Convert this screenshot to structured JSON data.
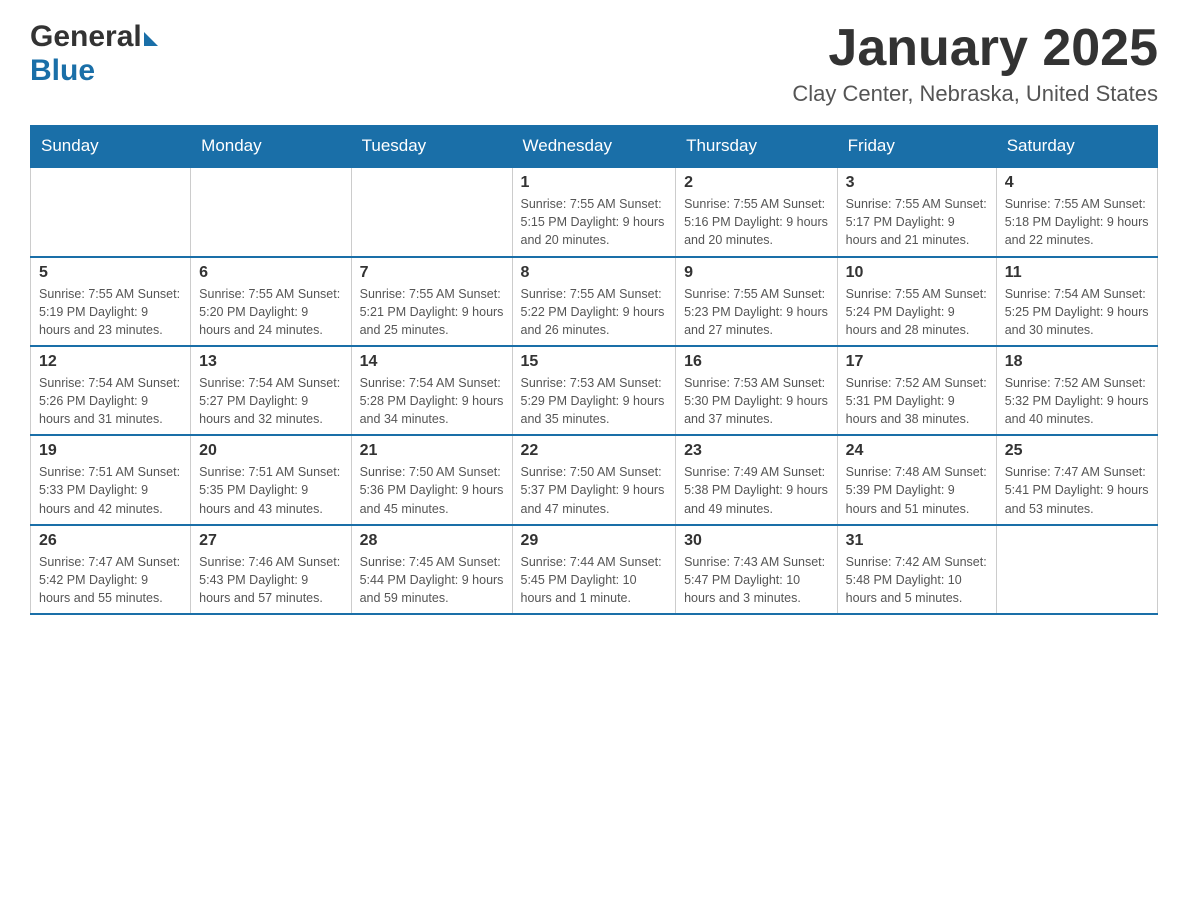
{
  "header": {
    "title": "January 2025",
    "location": "Clay Center, Nebraska, United States",
    "logo_general": "General",
    "logo_blue": "Blue"
  },
  "weekdays": [
    "Sunday",
    "Monday",
    "Tuesday",
    "Wednesday",
    "Thursday",
    "Friday",
    "Saturday"
  ],
  "weeks": [
    [
      {
        "day": "",
        "info": ""
      },
      {
        "day": "",
        "info": ""
      },
      {
        "day": "",
        "info": ""
      },
      {
        "day": "1",
        "info": "Sunrise: 7:55 AM\nSunset: 5:15 PM\nDaylight: 9 hours\nand 20 minutes."
      },
      {
        "day": "2",
        "info": "Sunrise: 7:55 AM\nSunset: 5:16 PM\nDaylight: 9 hours\nand 20 minutes."
      },
      {
        "day": "3",
        "info": "Sunrise: 7:55 AM\nSunset: 5:17 PM\nDaylight: 9 hours\nand 21 minutes."
      },
      {
        "day": "4",
        "info": "Sunrise: 7:55 AM\nSunset: 5:18 PM\nDaylight: 9 hours\nand 22 minutes."
      }
    ],
    [
      {
        "day": "5",
        "info": "Sunrise: 7:55 AM\nSunset: 5:19 PM\nDaylight: 9 hours\nand 23 minutes."
      },
      {
        "day": "6",
        "info": "Sunrise: 7:55 AM\nSunset: 5:20 PM\nDaylight: 9 hours\nand 24 minutes."
      },
      {
        "day": "7",
        "info": "Sunrise: 7:55 AM\nSunset: 5:21 PM\nDaylight: 9 hours\nand 25 minutes."
      },
      {
        "day": "8",
        "info": "Sunrise: 7:55 AM\nSunset: 5:22 PM\nDaylight: 9 hours\nand 26 minutes."
      },
      {
        "day": "9",
        "info": "Sunrise: 7:55 AM\nSunset: 5:23 PM\nDaylight: 9 hours\nand 27 minutes."
      },
      {
        "day": "10",
        "info": "Sunrise: 7:55 AM\nSunset: 5:24 PM\nDaylight: 9 hours\nand 28 minutes."
      },
      {
        "day": "11",
        "info": "Sunrise: 7:54 AM\nSunset: 5:25 PM\nDaylight: 9 hours\nand 30 minutes."
      }
    ],
    [
      {
        "day": "12",
        "info": "Sunrise: 7:54 AM\nSunset: 5:26 PM\nDaylight: 9 hours\nand 31 minutes."
      },
      {
        "day": "13",
        "info": "Sunrise: 7:54 AM\nSunset: 5:27 PM\nDaylight: 9 hours\nand 32 minutes."
      },
      {
        "day": "14",
        "info": "Sunrise: 7:54 AM\nSunset: 5:28 PM\nDaylight: 9 hours\nand 34 minutes."
      },
      {
        "day": "15",
        "info": "Sunrise: 7:53 AM\nSunset: 5:29 PM\nDaylight: 9 hours\nand 35 minutes."
      },
      {
        "day": "16",
        "info": "Sunrise: 7:53 AM\nSunset: 5:30 PM\nDaylight: 9 hours\nand 37 minutes."
      },
      {
        "day": "17",
        "info": "Sunrise: 7:52 AM\nSunset: 5:31 PM\nDaylight: 9 hours\nand 38 minutes."
      },
      {
        "day": "18",
        "info": "Sunrise: 7:52 AM\nSunset: 5:32 PM\nDaylight: 9 hours\nand 40 minutes."
      }
    ],
    [
      {
        "day": "19",
        "info": "Sunrise: 7:51 AM\nSunset: 5:33 PM\nDaylight: 9 hours\nand 42 minutes."
      },
      {
        "day": "20",
        "info": "Sunrise: 7:51 AM\nSunset: 5:35 PM\nDaylight: 9 hours\nand 43 minutes."
      },
      {
        "day": "21",
        "info": "Sunrise: 7:50 AM\nSunset: 5:36 PM\nDaylight: 9 hours\nand 45 minutes."
      },
      {
        "day": "22",
        "info": "Sunrise: 7:50 AM\nSunset: 5:37 PM\nDaylight: 9 hours\nand 47 minutes."
      },
      {
        "day": "23",
        "info": "Sunrise: 7:49 AM\nSunset: 5:38 PM\nDaylight: 9 hours\nand 49 minutes."
      },
      {
        "day": "24",
        "info": "Sunrise: 7:48 AM\nSunset: 5:39 PM\nDaylight: 9 hours\nand 51 minutes."
      },
      {
        "day": "25",
        "info": "Sunrise: 7:47 AM\nSunset: 5:41 PM\nDaylight: 9 hours\nand 53 minutes."
      }
    ],
    [
      {
        "day": "26",
        "info": "Sunrise: 7:47 AM\nSunset: 5:42 PM\nDaylight: 9 hours\nand 55 minutes."
      },
      {
        "day": "27",
        "info": "Sunrise: 7:46 AM\nSunset: 5:43 PM\nDaylight: 9 hours\nand 57 minutes."
      },
      {
        "day": "28",
        "info": "Sunrise: 7:45 AM\nSunset: 5:44 PM\nDaylight: 9 hours\nand 59 minutes."
      },
      {
        "day": "29",
        "info": "Sunrise: 7:44 AM\nSunset: 5:45 PM\nDaylight: 10 hours\nand 1 minute."
      },
      {
        "day": "30",
        "info": "Sunrise: 7:43 AM\nSunset: 5:47 PM\nDaylight: 10 hours\nand 3 minutes."
      },
      {
        "day": "31",
        "info": "Sunrise: 7:42 AM\nSunset: 5:48 PM\nDaylight: 10 hours\nand 5 minutes."
      },
      {
        "day": "",
        "info": ""
      }
    ]
  ]
}
